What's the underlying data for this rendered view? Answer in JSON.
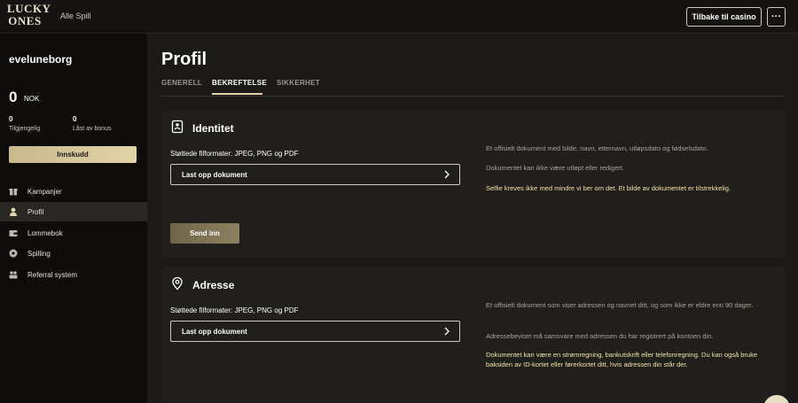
{
  "header": {
    "logo_line1": "LUCKY",
    "logo_line2": "ONES",
    "nav_all_games": "Alle Spill",
    "back_button": "Tilbake til casino",
    "more_button": "···"
  },
  "sidebar": {
    "username": "eveluneborg",
    "balance": "0",
    "currency": "NOK",
    "available_value": "0",
    "available_label": "Tilgjengelig",
    "locked_value": "0",
    "locked_label": "Låst av bonus",
    "deposit_button": "Innskudd",
    "menu": [
      {
        "label": "Kampanjer",
        "icon": "gift-icon"
      },
      {
        "label": "Profil",
        "icon": "user-icon"
      },
      {
        "label": "Lommebok",
        "icon": "wallet-icon"
      },
      {
        "label": "Spilling",
        "icon": "gaming-icon"
      },
      {
        "label": "Referral system",
        "icon": "referral-icon"
      }
    ],
    "active_item": "Profil"
  },
  "main": {
    "title": "Profil",
    "tabs": [
      {
        "label": "GENERELL"
      },
      {
        "label": "BEKREFTELSE"
      },
      {
        "label": "SIKKERHET"
      }
    ],
    "active_tab": "BEKREFTELSE",
    "identity": {
      "title": "Identitet",
      "icon": "id-badge-icon",
      "formats": "Støttede filformater: JPEG, PNG og PDF",
      "upload_label": "Last opp dokument",
      "submit_label": "Send inn",
      "info1": "Et offisielt dokument med bilde, navn, etternavn, utløpsdato og fødselsdato.",
      "info2": "Dokumentet kan ikke være utløpt eller redigert.",
      "info3": "Selfie kreves ikke med mindre vi ber om det. Et bilde av dokumentet er tilstrekkelig."
    },
    "address": {
      "title": "Adresse",
      "icon": "location-icon",
      "formats": "Støttede filformater: JPEG, PNG og PDF",
      "upload_label": "Last opp dokument",
      "info1": "Et offisielt dokument som viser adressen og navnet ditt, og som ikke er eldre enn 90 dager.",
      "info2": "Adressebeviset må samsvare med adressen du har registrert på kontoen din.",
      "info3": "Dokumentet kan være en strømregning, bankutskrift eller telefonregning. Du kan også bruke baksiden av ID-kortet eller førerkortet ditt, hvis adressen din står der."
    }
  },
  "colors": {
    "accent_gold": "#e2d4a8",
    "highlight_text": "#f0e3a6",
    "sidebar_bg": "#0d0c0b",
    "content_bg": "#1b1a17",
    "card_bg": "#201f1b"
  }
}
